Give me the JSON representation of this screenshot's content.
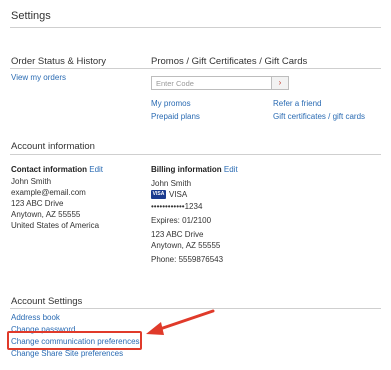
{
  "page": {
    "title": "Settings"
  },
  "order_status": {
    "heading": "Order Status & History",
    "view_orders_link": "View my orders"
  },
  "promos": {
    "heading": "Promos / Gift Certificates / Gift Cards",
    "code_placeholder": "Enter Code",
    "submit_glyph": "›",
    "links": {
      "my_promos": "My promos",
      "refer_friend": "Refer a friend",
      "prepaid_plans": "Prepaid plans",
      "gift_certificates": "Gift certificates / gift cards"
    }
  },
  "account_info": {
    "heading": "Account information",
    "contact": {
      "label": "Contact information",
      "edit": "Edit",
      "name": "John Smith",
      "email": "example@email.com",
      "street": "123 ABC Drive",
      "city": "Anytown, AZ 55555",
      "country": "United States of America"
    },
    "billing": {
      "label": "Billing information",
      "edit": "Edit",
      "name": "John Smith",
      "card_brand": "VISA",
      "card_logo_text": "VISA",
      "card_number": "••••••••••••1234",
      "expires": "Expires: 01/2100",
      "street": "123 ABC Drive",
      "city": "Anytown, AZ 55555",
      "phone": "Phone: 5559876543"
    }
  },
  "account_settings": {
    "heading": "Account Settings",
    "links": {
      "address_book": "Address book",
      "change_password": "Change password",
      "change_comm_prefs": "Change communication preferences",
      "change_share_prefs": "Change Share Site preferences"
    }
  },
  "colors": {
    "link": "#2a6bb3",
    "highlight": "#e03a2a",
    "rule": "#cfcfcf"
  }
}
